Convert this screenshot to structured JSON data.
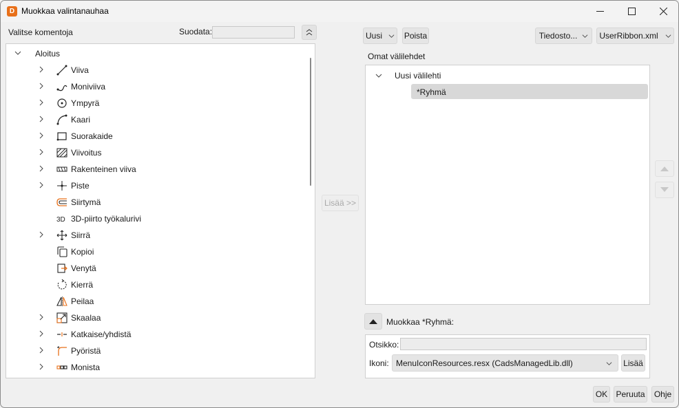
{
  "window": {
    "app_icon_letter": "D",
    "title": "Muokkaa valintanauhaa"
  },
  "left": {
    "header_label": "Valitse komentoja",
    "filter_label": "Suodata:",
    "filter_value": "",
    "tree_root": "Aloitus",
    "items": [
      {
        "label": "Viiva",
        "icon": "line-icon",
        "expandable": true
      },
      {
        "label": "Moniviiva",
        "icon": "polyline-icon",
        "expandable": true
      },
      {
        "label": "Ympyrä",
        "icon": "circle-icon",
        "expandable": true
      },
      {
        "label": "Kaari",
        "icon": "arc-icon",
        "expandable": true
      },
      {
        "label": "Suorakaide",
        "icon": "rectangle-icon",
        "expandable": true
      },
      {
        "label": "Viivoitus",
        "icon": "hatch-icon",
        "expandable": true
      },
      {
        "label": "Rakenteinen viiva",
        "icon": "structured-line-icon",
        "expandable": true
      },
      {
        "label": "Piste",
        "icon": "point-icon",
        "expandable": true
      },
      {
        "label": "Siirtymä",
        "icon": "offset-icon",
        "expandable": false
      },
      {
        "label": "3D-piirto työkalurivi",
        "icon": "3d-icon",
        "expandable": false
      },
      {
        "label": "Siirrä",
        "icon": "move-icon",
        "expandable": true
      },
      {
        "label": "Kopioi",
        "icon": "copy-icon",
        "expandable": false
      },
      {
        "label": "Venytä",
        "icon": "stretch-icon",
        "expandable": false
      },
      {
        "label": "Kierrä",
        "icon": "rotate-icon",
        "expandable": false
      },
      {
        "label": "Peilaa",
        "icon": "mirror-icon",
        "expandable": false
      },
      {
        "label": "Skaalaa",
        "icon": "scale-icon",
        "expandable": true
      },
      {
        "label": "Katkaise/yhdistä",
        "icon": "break-join-icon",
        "expandable": true
      },
      {
        "label": "Pyöristä",
        "icon": "fillet-icon",
        "expandable": true
      },
      {
        "label": "Monista",
        "icon": "array-icon",
        "expandable": true
      }
    ]
  },
  "middle": {
    "add_button": "Lisää >>"
  },
  "right": {
    "new_button": "Uusi",
    "delete_button": "Poista",
    "file_button": "Tiedosto...",
    "ribbon_file": "UserRibbon.xml",
    "tabs_label": "Omat välilehdet",
    "tab_node": "Uusi välilehti",
    "group_node": "*Ryhmä",
    "edit_label": "Muokkaa *Ryhmä:",
    "caption_label": "Otsikko:",
    "caption_value": "",
    "icon_label": "Ikoni:",
    "icon_value": "MenuIconResources.resx (CadsManagedLib.dll)",
    "icon_add_button": "Lisää"
  },
  "footer": {
    "ok": "OK",
    "cancel": "Peruuta",
    "help": "Ohje"
  }
}
